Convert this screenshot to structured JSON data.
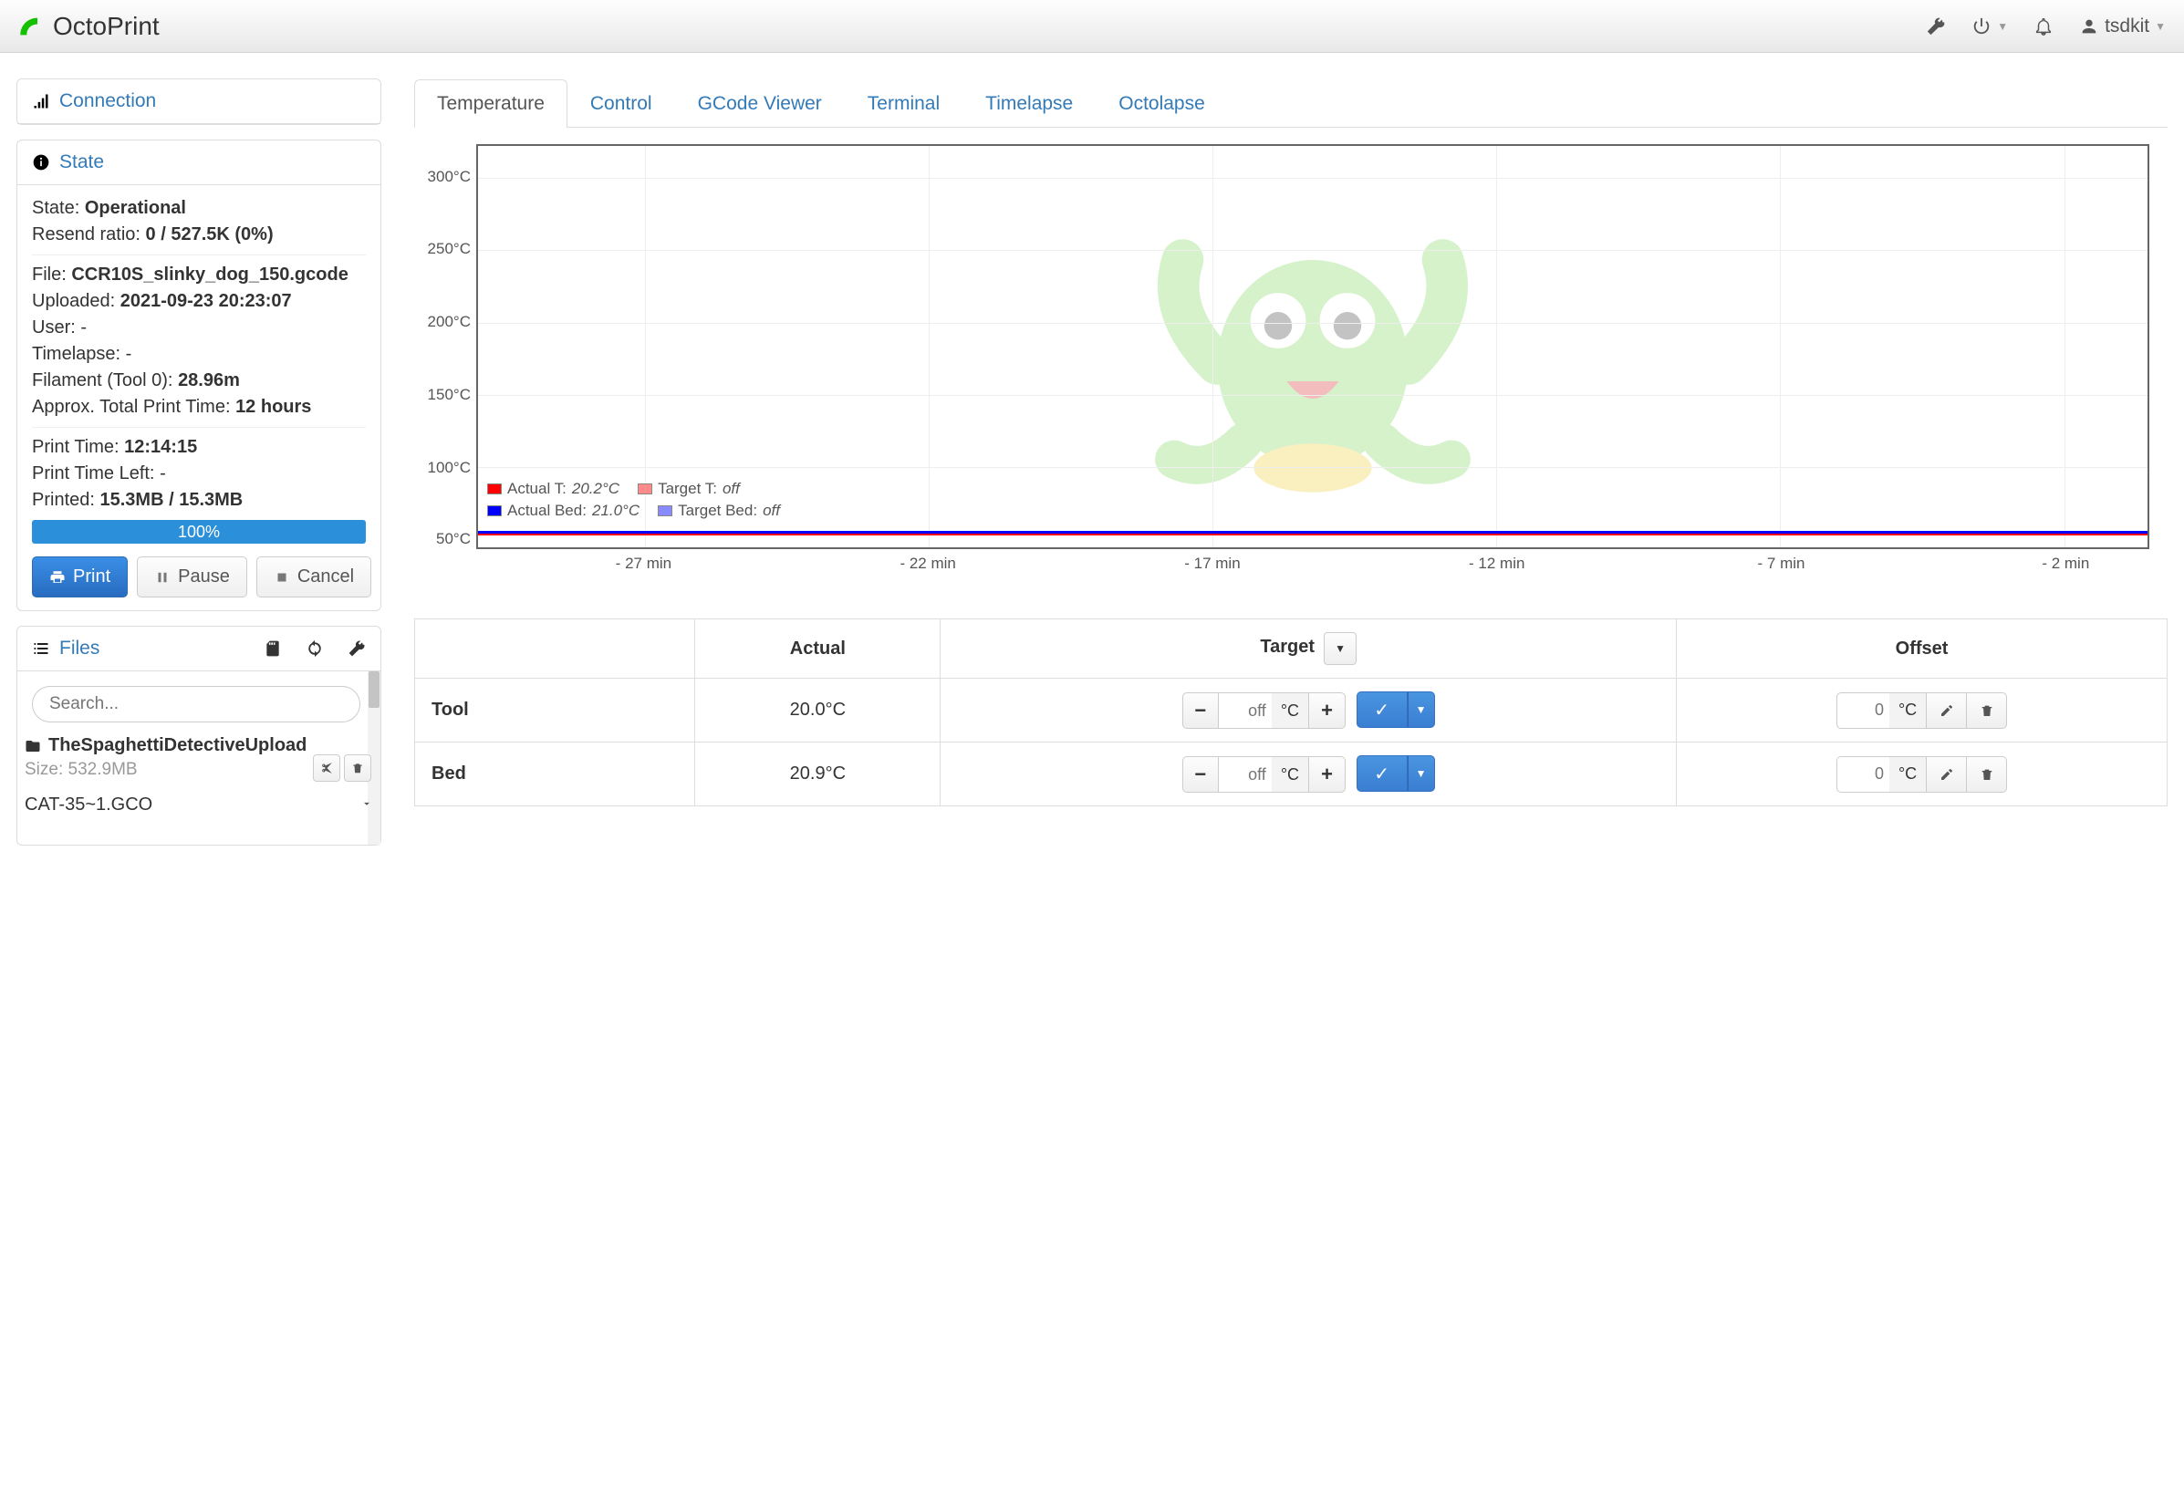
{
  "app": {
    "title": "OctoPrint",
    "username": "tsdkit"
  },
  "sidebar": {
    "connection": {
      "heading": "Connection"
    },
    "state": {
      "heading": "State",
      "state_label": "State:",
      "state_value": "Operational",
      "resend_label": "Resend ratio:",
      "resend_value": "0 / 527.5K (0%)",
      "file_label": "File:",
      "file_value": "CCR10S_slinky_dog_150.gcode",
      "uploaded_label": "Uploaded:",
      "uploaded_value": "2021-09-23 20:23:07",
      "user_label": "User:",
      "user_value": "-",
      "timelapse_label": "Timelapse:",
      "timelapse_value": "-",
      "filament_label": "Filament (Tool 0):",
      "filament_value": "28.96m",
      "approx_label": "Approx. Total Print Time:",
      "approx_value": "12 hours",
      "printtime_label": "Print Time:",
      "printtime_value": "12:14:15",
      "printtimeleft_label": "Print Time Left:",
      "printtimeleft_value": "-",
      "printed_label": "Printed:",
      "printed_value": "15.3MB / 15.3MB",
      "progress_pct": "100%",
      "print_btn": "Print",
      "pause_btn": "Pause",
      "cancel_btn": "Cancel"
    },
    "files": {
      "heading": "Files",
      "search_placeholder": "Search...",
      "folder_name": "TheSpaghettiDetectiveUpload",
      "folder_size_label": "Size:",
      "folder_size": "532.9MB",
      "file2_name": "CAT-35~1.GCO"
    }
  },
  "tabs": [
    "Temperature",
    "Control",
    "GCode Viewer",
    "Terminal",
    "Timelapse",
    "Octolapse"
  ],
  "chart_data": {
    "type": "line",
    "x_unit": "min",
    "x_ticks": [
      "- 27 min",
      "- 22 min",
      "- 17 min",
      "- 12 min",
      "- 7 min",
      "- 2 min"
    ],
    "y_ticks": [
      "50°C",
      "100°C",
      "150°C",
      "200°C",
      "250°C",
      "300°C"
    ],
    "ylim": [
      0,
      310
    ],
    "series": [
      {
        "name": "Actual T",
        "legend": "Actual T:",
        "current": "20.2°C",
        "color": "#ff0000",
        "approx_y": 20.2
      },
      {
        "name": "Target T",
        "legend": "Target T:",
        "current": "off",
        "color": "#ff8a8a",
        "approx_y": null
      },
      {
        "name": "Actual Bed",
        "legend": "Actual Bed:",
        "current": "21.0°C",
        "color": "#0000ff",
        "approx_y": 21.0
      },
      {
        "name": "Target Bed",
        "legend": "Target Bed:",
        "current": "off",
        "color": "#8a8aff",
        "approx_y": null
      }
    ]
  },
  "temp_table": {
    "headers": {
      "actual": "Actual",
      "target": "Target",
      "offset": "Offset"
    },
    "rows": [
      {
        "label": "Tool",
        "actual": "20.0°C",
        "target_placeholder": "off",
        "unit": "°C",
        "offset": "0"
      },
      {
        "label": "Bed",
        "actual": "20.9°C",
        "target_placeholder": "off",
        "unit": "°C",
        "offset": "0"
      }
    ]
  }
}
